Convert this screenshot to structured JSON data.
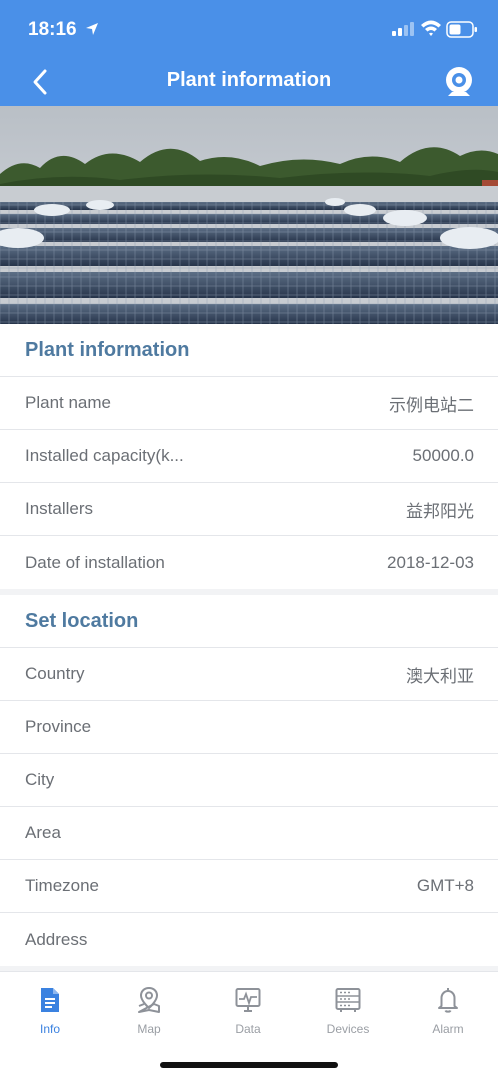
{
  "status": {
    "time": "18:16"
  },
  "header": {
    "title": "Plant information"
  },
  "plant_info": {
    "title": "Plant information",
    "rows": [
      {
        "label": "Plant name",
        "value": "示例电站二"
      },
      {
        "label": "Installed capacity(k...",
        "value": "50000.0"
      },
      {
        "label": "Installers",
        "value": "益邦阳光"
      },
      {
        "label": "Date of installation",
        "value": "2018-12-03"
      }
    ]
  },
  "location": {
    "title": "Set location",
    "rows": [
      {
        "label": "Country",
        "value": "澳大利亚"
      },
      {
        "label": "Province",
        "value": ""
      },
      {
        "label": "City",
        "value": ""
      },
      {
        "label": "Area",
        "value": ""
      },
      {
        "label": "Timezone",
        "value": "GMT+8"
      },
      {
        "label": "Address",
        "value": ""
      }
    ]
  },
  "tabs": [
    {
      "label": "Info",
      "icon": "document-icon",
      "active": true
    },
    {
      "label": "Map",
      "icon": "map-icon",
      "active": false
    },
    {
      "label": "Data",
      "icon": "monitor-icon",
      "active": false
    },
    {
      "label": "Devices",
      "icon": "devices-icon",
      "active": false
    },
    {
      "label": "Alarm",
      "icon": "bell-icon",
      "active": false
    }
  ],
  "colors": {
    "header": "#4a90e8",
    "section_title": "#4f7aa0",
    "active_tab": "#3b82e0",
    "inactive_tab": "#9a9ea4"
  }
}
